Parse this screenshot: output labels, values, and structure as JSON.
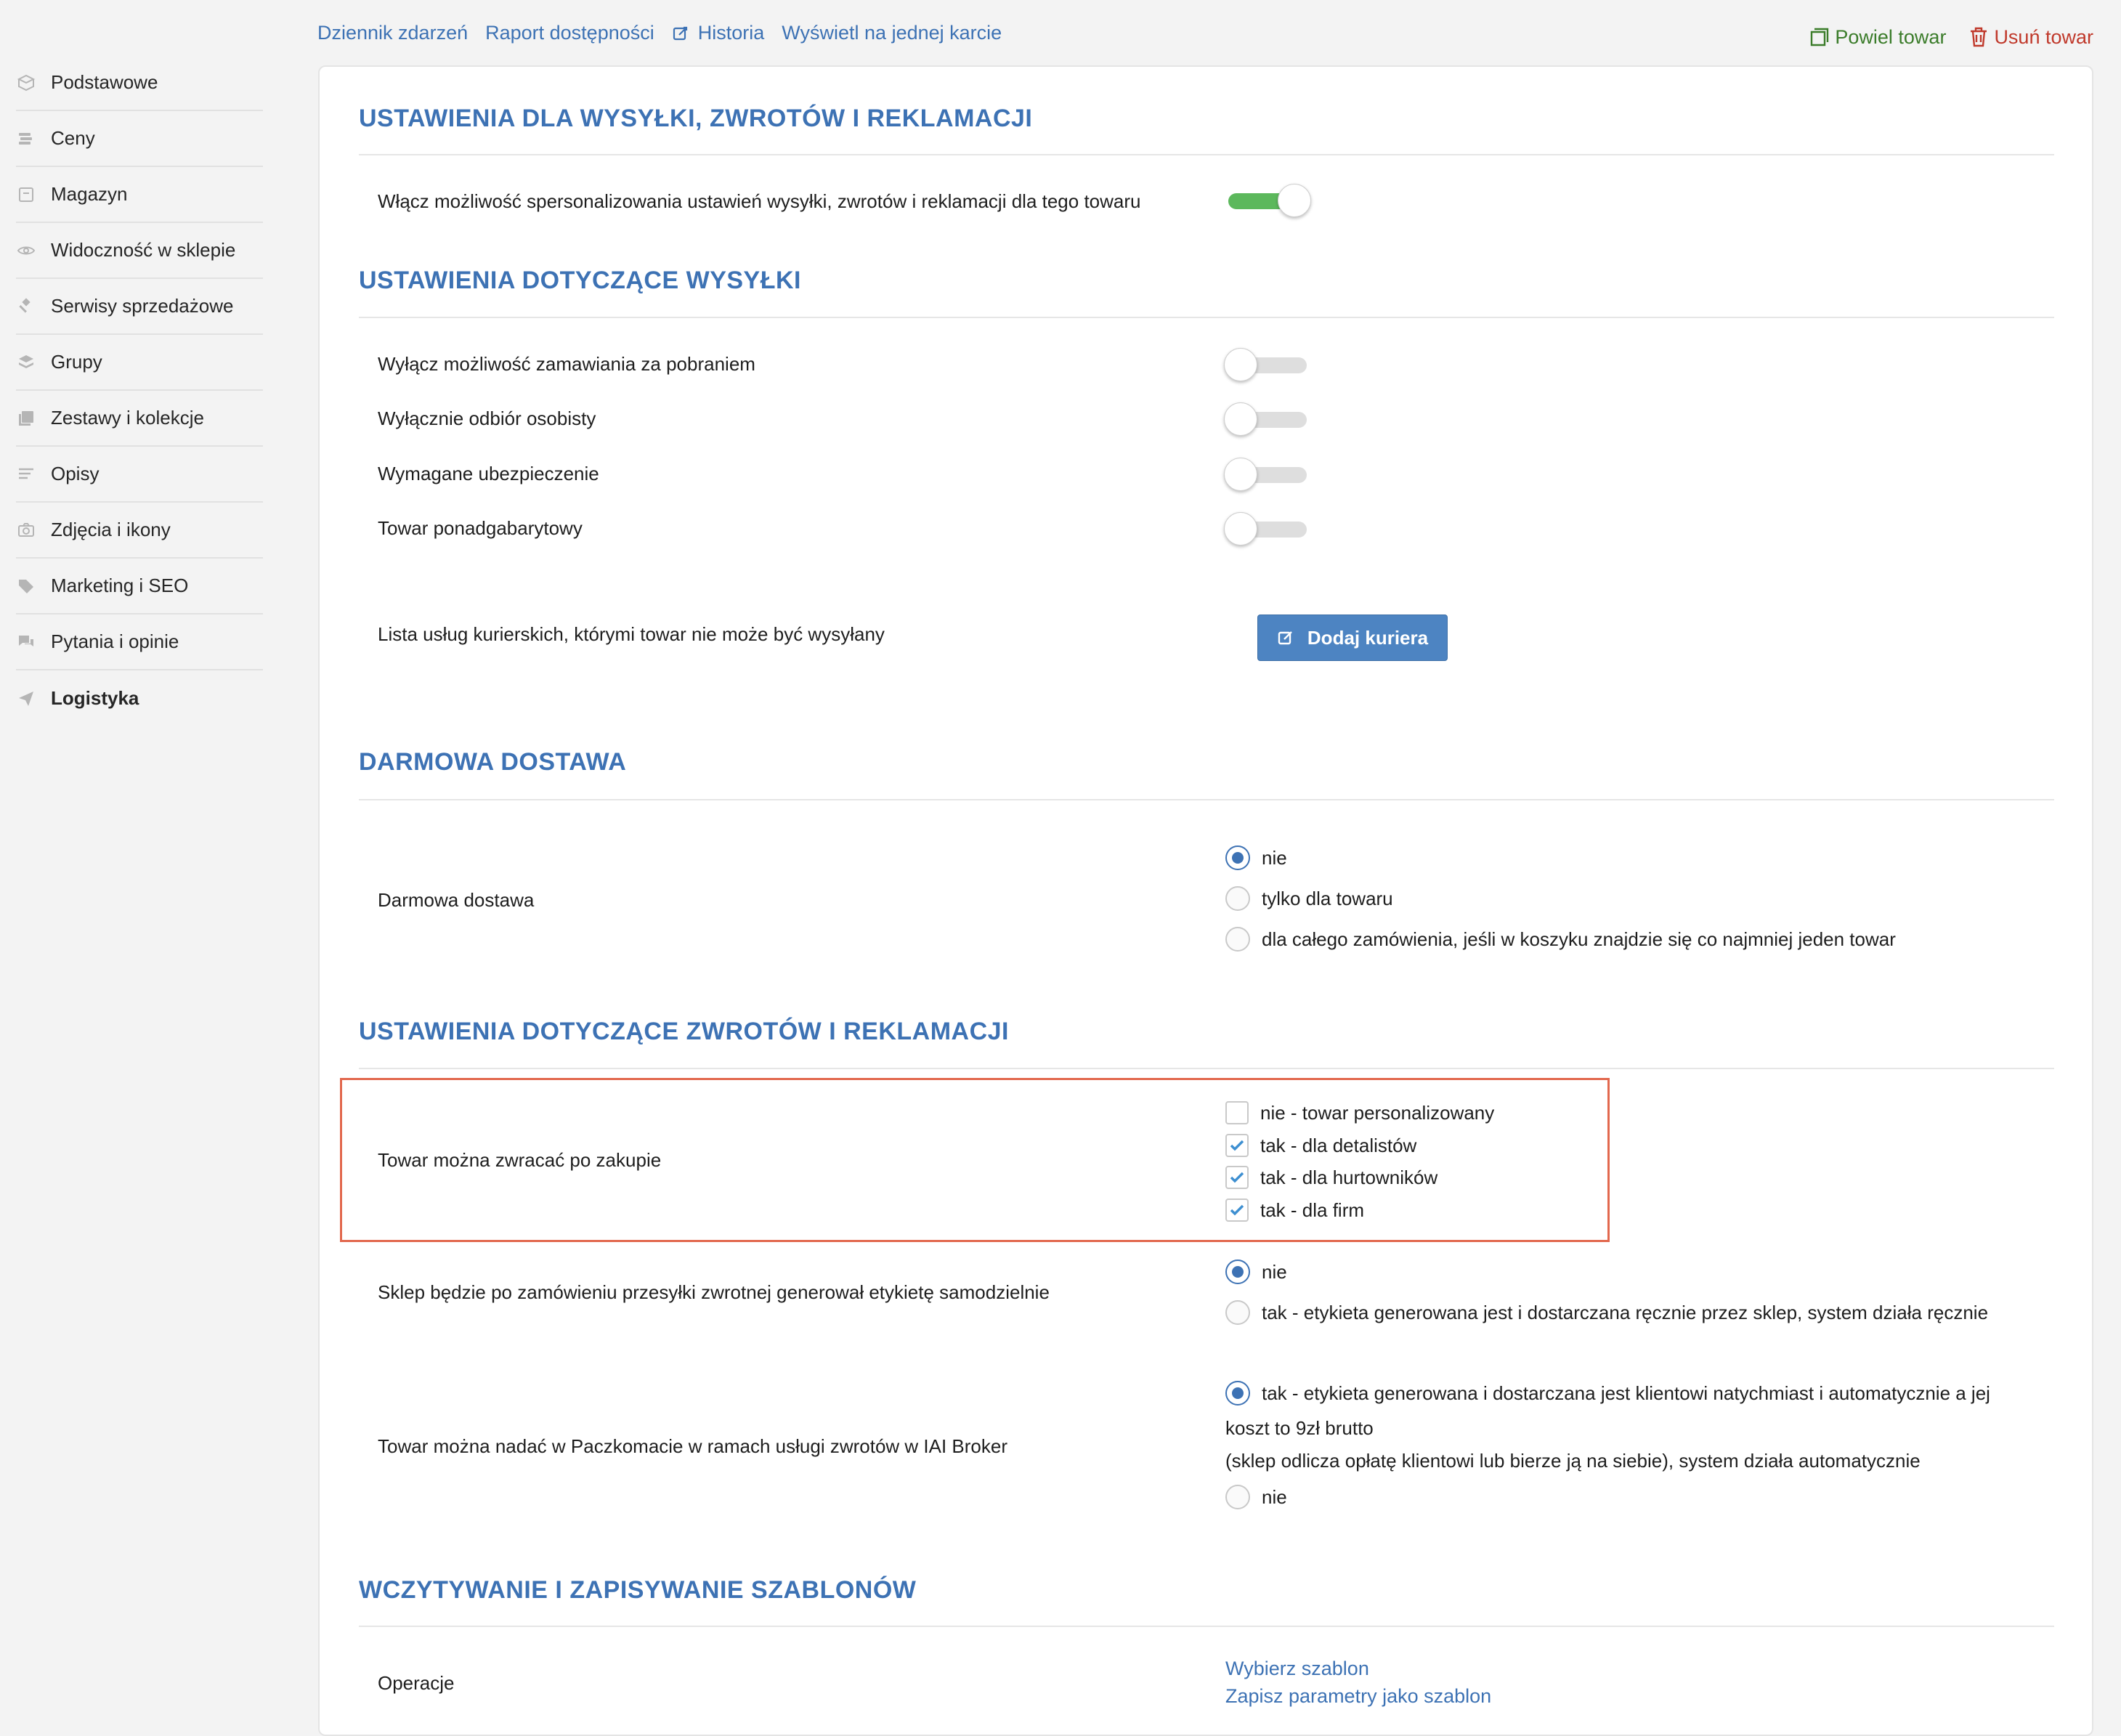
{
  "top_links": [
    {
      "label": "Dziennik zdarzeń"
    },
    {
      "label": "Raport dostępności"
    },
    {
      "label": "Historia",
      "icon": "edit-icon"
    },
    {
      "label": "Wyświetl na jednej karcie"
    }
  ],
  "actions": {
    "copy": {
      "label": "Powiel towar",
      "icon": "copy-icon",
      "color": "#3b7c2a"
    },
    "delete": {
      "label": "Usuń towar",
      "icon": "trash-icon",
      "color": "#c0392b"
    }
  },
  "sidebar": {
    "items": [
      {
        "label": "Podstawowe",
        "icon": "box-icon"
      },
      {
        "label": "Ceny",
        "icon": "coins-icon"
      },
      {
        "label": "Magazyn",
        "icon": "warehouse-icon"
      },
      {
        "label": "Widoczność w sklepie",
        "icon": "eye-icon"
      },
      {
        "label": "Serwisy sprzedażowe",
        "icon": "gavel-icon"
      },
      {
        "label": "Grupy",
        "icon": "layers-icon"
      },
      {
        "label": "Zestawy i kolekcje",
        "icon": "collection-icon"
      },
      {
        "label": "Opisy",
        "icon": "text-icon"
      },
      {
        "label": "Zdjęcia i ikony",
        "icon": "camera-icon"
      },
      {
        "label": "Marketing i SEO",
        "icon": "tags-icon"
      },
      {
        "label": "Pytania i opinie",
        "icon": "comments-icon"
      },
      {
        "label": "Logistyka",
        "icon": "send-icon",
        "active": true
      }
    ]
  },
  "sections": {
    "shipping_returns": {
      "title": "USTAWIENIA DLA WYSYŁKI, ZWROTÓW I REKLAMACJI",
      "personalize_label": "Włącz możliwość spersonalizowania ustawień wysyłki, zwrotów i reklamacji dla tego towaru",
      "personalize_on": true
    },
    "shipping": {
      "title": "USTAWIENIA DOTYCZĄCE WYSYŁKI",
      "toggles": [
        {
          "label": "Wyłącz możliwość zamawiania za pobraniem",
          "on": false
        },
        {
          "label": "Wyłącznie odbiór osobisty",
          "on": false
        },
        {
          "label": "Wymagane ubezpieczenie",
          "on": false
        },
        {
          "label": "Towar ponadgabarytowy",
          "on": false
        }
      ],
      "couriers_label": "Lista usług kurierskich, którymi towar nie może być wysyłany",
      "add_courier_button": "Dodaj kuriera"
    },
    "free_delivery": {
      "title": "DARMOWA DOSTAWA",
      "label": "Darmowa dostawa",
      "options": [
        {
          "label": "nie",
          "checked": true
        },
        {
          "label": "tylko dla towaru",
          "checked": false
        },
        {
          "label": "dla całego zamówienia, jeśli w koszyku znajdzie się co najmniej jeden towar",
          "checked": false
        }
      ]
    },
    "returns": {
      "title": "USTAWIENIA DOTYCZĄCE ZWROTÓW I REKLAMACJI",
      "returnable_label": "Towar można zwracać po zakupie",
      "returnable_options": [
        {
          "label": "nie - towar personalizowany",
          "checked": false
        },
        {
          "label": "tak - dla detalistów",
          "checked": true
        },
        {
          "label": "tak - dla hurtowników",
          "checked": true
        },
        {
          "label": "tak - dla firm",
          "checked": true
        }
      ],
      "label_gen_label": "Sklep będzie po zamówieniu przesyłki zwrotnej generował etykietę samodzielnie",
      "label_gen_options": [
        {
          "label": "nie",
          "checked": true
        },
        {
          "label": "tak - etykieta generowana jest i dostarczana ręcznie przez sklep, system działa ręcznie",
          "checked": false
        }
      ],
      "paczkomat_label": "Towar można nadać w Paczkomacie w ramach usługi zwrotów w IAI Broker",
      "paczkomat_yes_line1": "tak - etykieta generowana i dostarczana jest klientowi natychmiast i automatycznie a jej",
      "paczkomat_yes_line2": "koszt to 9zł brutto",
      "paczkomat_yes_line3": "(sklep odlicza opłatę klientowi lub bierze ją na siebie), system działa automatycznie",
      "paczkomat_yes_checked": true,
      "paczkomat_no": "nie",
      "paczkomat_no_checked": false
    },
    "templates": {
      "title": "WCZYTYWANIE I ZAPISYWANIE SZABLONÓW",
      "label": "Operacje",
      "choose_link": "Wybierz szablon",
      "save_link": "Zapisz parametry jako szablon"
    }
  },
  "colors": {
    "accent": "#3d72b4",
    "toggle_on": "#5cb85c",
    "highlight_border": "#e2684e"
  }
}
